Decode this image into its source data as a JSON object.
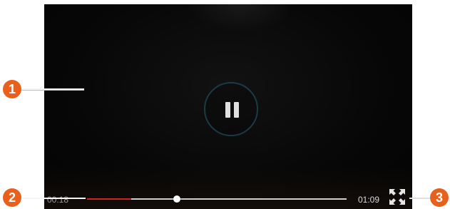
{
  "player": {
    "state": "playing",
    "current_time": "00:18",
    "total_time": "01:09",
    "progress_fraction": 0.345,
    "played_fraction": 0.17,
    "progress_color": "#d32121",
    "track_color": "#cfcfcf",
    "controls": {
      "pause_icon": "pause-icon",
      "fullscreen_icon": "fullscreen-expand-icon"
    }
  },
  "callouts": [
    {
      "number": "1"
    },
    {
      "number": "2"
    },
    {
      "number": "3"
    }
  ],
  "colors": {
    "callout_badge": "#e8601c",
    "player_background": "#050505"
  }
}
